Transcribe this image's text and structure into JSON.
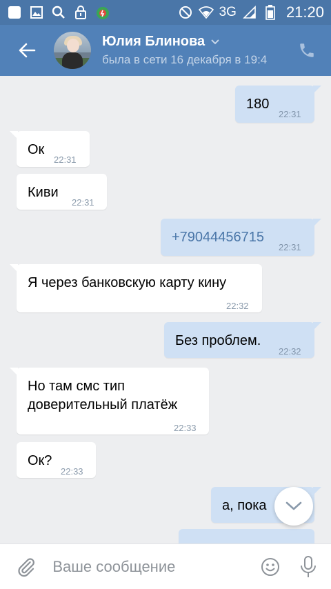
{
  "status_bar": {
    "network": "3G",
    "time": "21:20"
  },
  "header": {
    "contact_name": "Юлия Блинова",
    "last_seen": "была в сети 16 декабря в 19:4"
  },
  "messages": [
    {
      "direction": "out",
      "text": "180",
      "time": "22:31"
    },
    {
      "direction": "in",
      "text": "Ок",
      "time": "22:31"
    },
    {
      "direction": "in",
      "text": "Киви",
      "time": "22:31"
    },
    {
      "direction": "out",
      "text": "+79044456715",
      "time": "22:31"
    },
    {
      "direction": "in",
      "text": "Я через банковскую карту кину",
      "time": "22:32"
    },
    {
      "direction": "out",
      "text": "Без проблем.",
      "time": "22:32"
    },
    {
      "direction": "in",
      "text_line1": "Но там смс тип",
      "text_line2": "доверительный платёж",
      "time": "22:33"
    },
    {
      "direction": "in",
      "text": "Ок?",
      "time": "22:33"
    },
    {
      "direction": "out",
      "text": "а, пока",
      "time": ""
    }
  ],
  "composer": {
    "placeholder": "Ваше сообщение"
  },
  "icons": {
    "back": "arrow-left-icon",
    "call": "phone-icon",
    "attach": "paperclip-icon",
    "emoji": "smiley-icon",
    "mic": "microphone-icon",
    "scroll_down": "chevron-down-icon"
  },
  "colors": {
    "header": "#5181b8",
    "status_bar": "#4a76a8",
    "outgoing_bubble": "#cfe0f4",
    "incoming_bubble": "#ffffff",
    "background": "#edeef0"
  }
}
